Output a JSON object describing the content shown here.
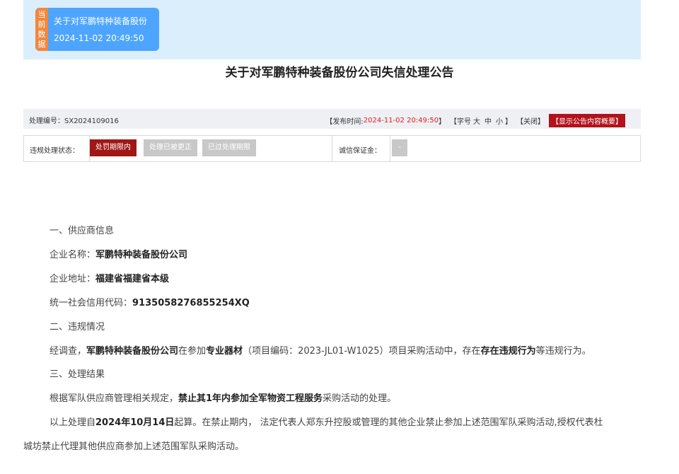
{
  "current_card": {
    "tag": [
      "当",
      "前",
      "数",
      "据"
    ],
    "title": "关于对军鹏特种装备股份",
    "time": "2024-11-02 20:49:50"
  },
  "page_title": "关于对军鹏特种装备股份公司失信处理公告",
  "info_bar": {
    "number_label": "处理编号：SX2024109016",
    "publish_prefix": "【发布时间:",
    "publish_time": "2024-11-02 20:49:50",
    "publish_suffix": "】",
    "font_prefix": "【字号",
    "font_large": "大",
    "font_medium": "中",
    "font_small": "小",
    "font_suffix": "】",
    "close": "【关闭】",
    "summary": "【显示公告内容概要】"
  },
  "status_row": {
    "label": "违规处理状态：",
    "buttons": [
      "处罚期限内",
      "处理已被更正",
      "已过处理期限"
    ],
    "deposit_label": "诚信保证金：",
    "deposit_value": "-"
  },
  "content": {
    "sec1": "一、供应商信息",
    "name_label": "企业名称：",
    "name": "军鹏特种装备股份公司",
    "addr_label": "企业地址：",
    "addr": "福建省福建省本级",
    "code_label": "统一社会信用代码：",
    "code": "91350582768552​54XQ",
    "sec2": "二、违规情况",
    "v_1": "经调查，",
    "v_2": "军鹏特种装备股份公司",
    "v_3": "在参加",
    "v_4": "专业器材",
    "v_5": "（项目编码：2023-JL01-W1025）项目采购活动中，存在",
    "v_6": "存在违规行为",
    "v_7": "等违规行为。",
    "sec3": "三、处理结果",
    "r_1": "根据军队供应商管理相关规定，",
    "r_2": "禁止其1年内参加全军物资工程服务",
    "r_3": "采购活动的处理。",
    "p_1": "以上处理自",
    "p_2": "2024年10月14日",
    "p_3": "起算。在禁止期内， 法定代表人郑东升控股或管理的其他企业禁止参加上述范围军队采购活动,授权代表杜",
    "p_4": "城坊禁止代理其他供应商参加上述范围军队采购活动。"
  }
}
